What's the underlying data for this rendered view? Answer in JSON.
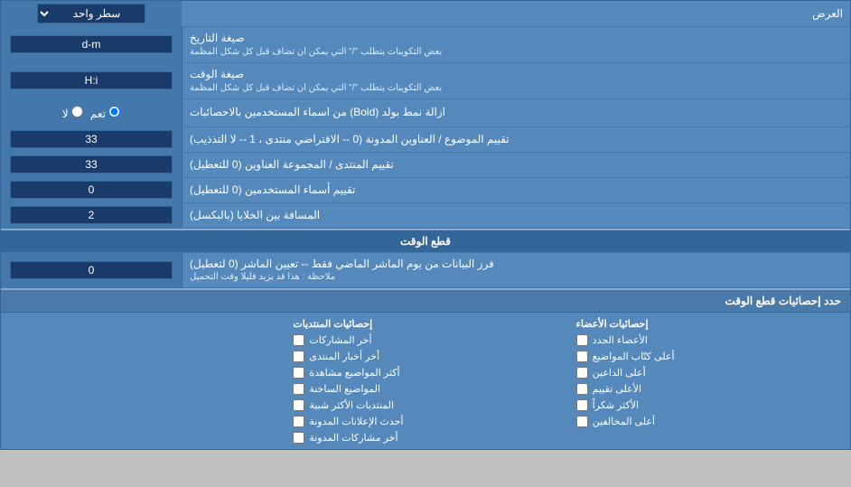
{
  "header": {
    "title": "العرض"
  },
  "rows": [
    {
      "id": "single-line",
      "label": "العرض",
      "inputType": "select",
      "inputValue": "سطر واحد",
      "labelSide": "right"
    },
    {
      "id": "date-format",
      "label": "صيغة التاريخ",
      "sublabel": "بعض التكوينات يتطلب \"/\" التي يمكن ان تضاف قبل كل شكل المظمة",
      "inputType": "text",
      "inputValue": "d-m"
    },
    {
      "id": "time-format",
      "label": "صيغة الوقت",
      "sublabel": "بعض التكوينات يتطلب \"/\" التي يمكن ان تضاف قبل كل شكل المظمة",
      "inputType": "text",
      "inputValue": "H:i"
    },
    {
      "id": "bold-remove",
      "label": "ازالة نمط بولد (Bold) من اسماء المستخدمين بالاحصائيات",
      "inputType": "radio",
      "radioOptions": [
        "تعم",
        "لا"
      ],
      "radioSelected": "تعم"
    },
    {
      "id": "topic-sort",
      "label": "تقييم الموضوع / العناوين المدونة (0 -- الافتراضي منتدى ، 1 -- لا التذذيب)",
      "inputType": "text",
      "inputValue": "33"
    },
    {
      "id": "forum-sort",
      "label": "تقييم المنتدى / المجموعة العناوين (0 للتعطيل)",
      "inputType": "text",
      "inputValue": "33"
    },
    {
      "id": "user-sort",
      "label": "تقييم أسماء المستخدمين (0 للتعطيل)",
      "inputType": "text",
      "inputValue": "0"
    },
    {
      "id": "cell-spacing",
      "label": "المسافة بين الخلايا (بالبكسل)",
      "inputType": "text",
      "inputValue": "2"
    }
  ],
  "section_cutoff": {
    "title": "قطع الوقت",
    "row": {
      "label": "فرز البيانات من يوم الماشر الماضي فقط -- تعيين الماشر (0 لتعطيل)",
      "note": "ملاحظة : هذا قد يزيد قليلا وقت التحميل",
      "inputValue": "0"
    },
    "stats_label": "حدد إحصائيات قطع الوقت"
  },
  "checkboxes": {
    "col1_header": "إحصائيات المنتديات",
    "col2_header": "إحصائيات الأعضاء",
    "col1_items": [
      "أخر المشاركات",
      "أخر أخبار المنتدى",
      "أكثر المواضيع مشاهدة",
      "المواضيع الساخنة",
      "المنتديات الأكثر شبية",
      "أحدث الإعلانات المدونة",
      "أخر مشاركات المدونة"
    ],
    "col2_items": [
      "الأعضاء الجدد",
      "أعلى كتّاب المواضيع",
      "أعلى الداعين",
      "الأعلى تقييم",
      "الأكثر شكراً",
      "أعلى المخالفين"
    ]
  }
}
